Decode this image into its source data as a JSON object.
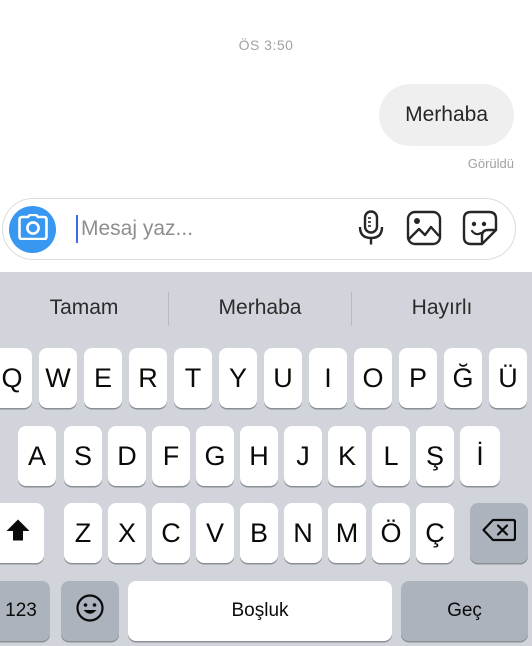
{
  "chat": {
    "timestamp": "ÖS 3:50",
    "messages": [
      {
        "text": "Merhaba",
        "from": "me"
      }
    ],
    "seen_label": "Görüldü"
  },
  "composer": {
    "placeholder": "Mesaj yaz...",
    "value": "",
    "icons": [
      "camera-icon",
      "microphone-icon",
      "gallery-icon",
      "sticker-icon"
    ],
    "accent_color": "#3897f0"
  },
  "keyboard": {
    "suggestions": [
      "Tamam",
      "Merhaba",
      "Hayırlı"
    ],
    "row1": [
      "Q",
      "W",
      "E",
      "R",
      "T",
      "Y",
      "U",
      "I",
      "O",
      "P",
      "Ğ",
      "Ü"
    ],
    "row2": [
      "A",
      "S",
      "D",
      "F",
      "G",
      "H",
      "J",
      "K",
      "L",
      "Ş",
      "İ"
    ],
    "row3": [
      "Z",
      "X",
      "C",
      "V",
      "B",
      "N",
      "M",
      "Ö",
      "Ç"
    ],
    "numbers_label": "123",
    "space_label": "Boşluk",
    "return_label": "Geç",
    "shift_icon": "shift-icon",
    "delete_icon": "backspace-icon",
    "emoji_icon": "emoji-icon"
  }
}
